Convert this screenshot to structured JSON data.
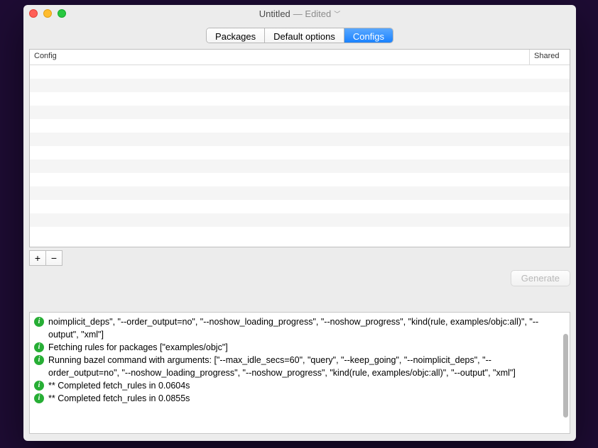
{
  "window": {
    "title": "Untitled",
    "status": "— Edited"
  },
  "tabs": {
    "packages": "Packages",
    "default_options": "Default options",
    "configs": "Configs"
  },
  "table": {
    "col_config": "Config",
    "col_shared": "Shared"
  },
  "buttons": {
    "add": "+",
    "remove": "−",
    "generate": "Generate"
  },
  "log": {
    "l1": "noimplicit_deps\", \"--order_output=no\", \"--noshow_loading_progress\", \"--noshow_progress\", \"kind(rule, examples/objc:all)\", \"--output\", \"xml\"]",
    "l2": "Fetching rules for packages [\"examples/objc\"]",
    "l3": "Running bazel command with arguments: [\"--max_idle_secs=60\", \"query\", \"--keep_going\", \"--noimplicit_deps\", \"--order_output=no\", \"--noshow_loading_progress\", \"--noshow_progress\", \"kind(rule, examples/objc:all)\", \"--output\", \"xml\"]",
    "l4": "** Completed fetch_rules in 0.0604s",
    "l5": "** Completed fetch_rules in 0.0855s"
  }
}
